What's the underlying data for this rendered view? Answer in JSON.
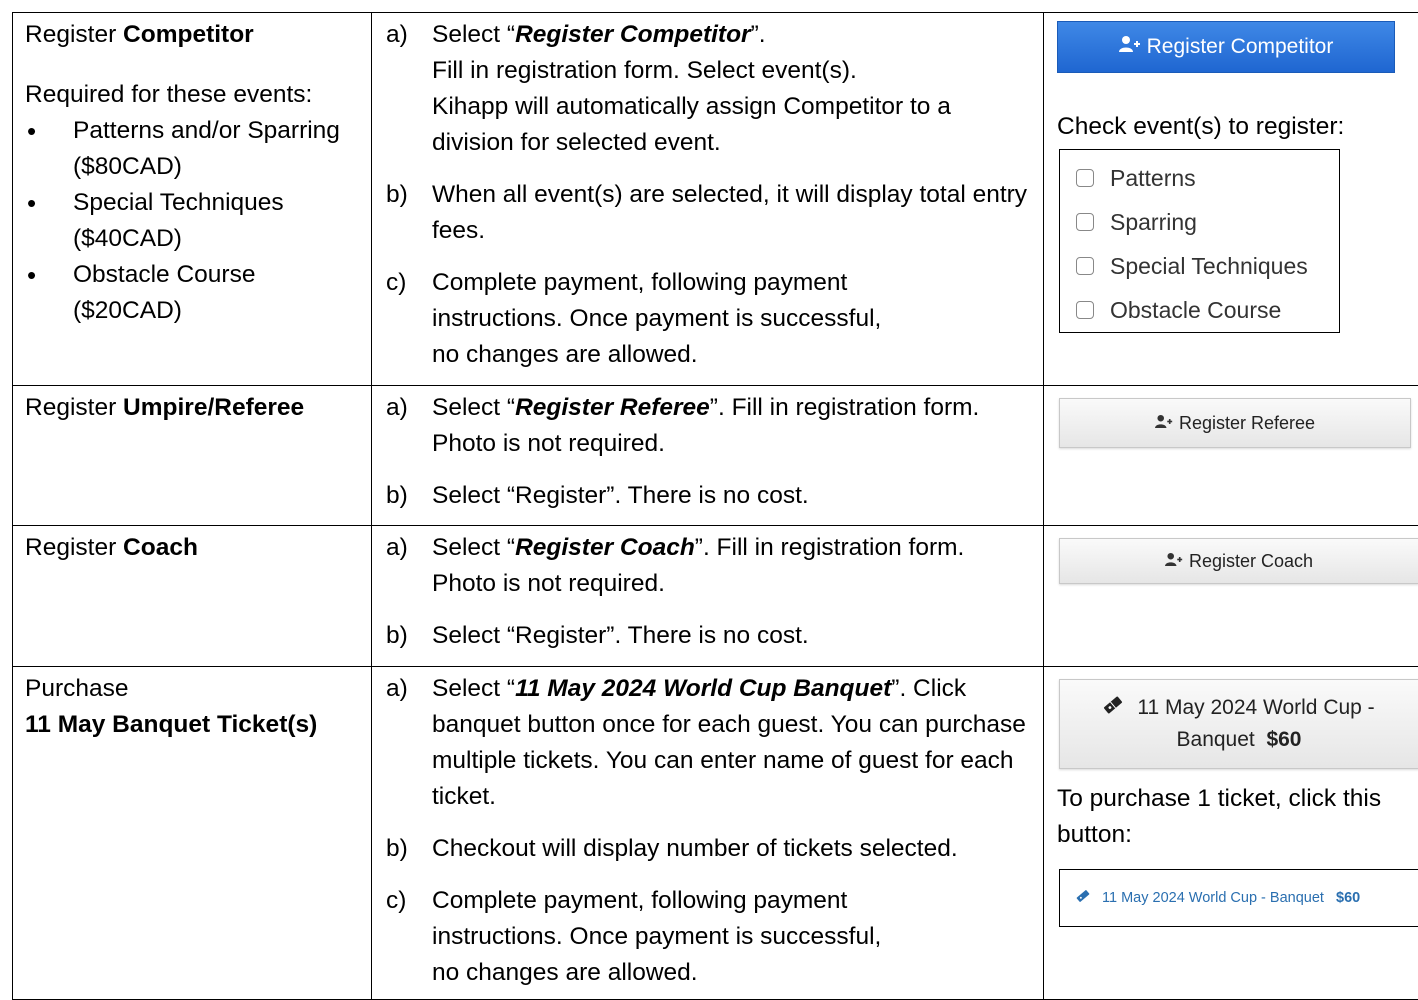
{
  "rows": {
    "competitor": {
      "title_prefix": "Register ",
      "title_bold": "Competitor",
      "required_text": "Required for these events:",
      "events": [
        "Patterns and/or Sparring ($80CAD)",
        "Special Techniques ($40CAD)",
        "Obstacle Course ($20CAD)"
      ],
      "steps": {
        "a": {
          "label": "a)",
          "pre": "Select “",
          "bi": "Register Competitor",
          "post": "”.",
          "line2": "Fill in registration form.  Select event(s).",
          "line3": "Kihapp will automatically assign Competitor to a division for selected event."
        },
        "b": {
          "label": "b)",
          "text": "When all event(s) are selected, it will display total entry fees."
        },
        "c": {
          "label": "c)",
          "line1": "Complete payment, following payment",
          "line2": "instructions.  Once payment is successful,",
          "line3": "no changes are allowed."
        }
      }
    },
    "referee": {
      "title_prefix": "Register ",
      "title_bold": "Umpire/Referee",
      "steps": {
        "a": {
          "label": "a)",
          "pre": "Select “",
          "bi": "Register Referee",
          "post": "”.  Fill in registration form.  Photo is not required."
        },
        "b": {
          "label": "b)",
          "text": "Select “Register”.  There is no cost."
        }
      }
    },
    "coach": {
      "title_prefix": "Register ",
      "title_bold": "Coach",
      "steps": {
        "a": {
          "label": "a)",
          "pre": "Select “",
          "bi": "Register Coach",
          "post": "”.  Fill in registration form.  Photo is not required."
        },
        "b": {
          "label": "b)",
          "text": "Select “Register”.  There is no cost."
        }
      }
    },
    "banquet": {
      "title_line1": "Purchase",
      "title_bold": "11 May Banquet Ticket(s)",
      "steps": {
        "a": {
          "label": "a)",
          "pre": "Select “",
          "bi": "11 May 2024 World Cup Banquet",
          "post": "”.  Click banquet button once for each guest.  You can purchase multiple tickets.  You can enter name of guest for each ticket."
        },
        "b": {
          "label": "b)",
          "text": "Checkout will display number of tickets selected."
        },
        "c": {
          "label": "c)",
          "line1": "Complete payment, following payment",
          "line2": "instructions.  Once payment is successful,",
          "line3": "no changes are allowed."
        }
      }
    }
  },
  "ui": {
    "register_competitor_button": "Register Competitor",
    "check_events_label": "Check event(s) to register:",
    "event_options": [
      "Patterns",
      "Sparring",
      "Special Techniques",
      "Obstacle Course"
    ],
    "register_referee_button": "Register Referee",
    "register_coach_button": "Register Coach",
    "banquet_button_line1": "11 May 2024 World Cup -",
    "banquet_button_line2": "Banquet",
    "banquet_button_price": "$60",
    "ticket_note": "To purchase 1 ticket, click this button:",
    "banquet_small_button": "11 May 2024 World Cup - Banquet",
    "banquet_small_price": "$60",
    "icons": {
      "user_add": "user-add-icon",
      "ticket": "ticket-icon"
    },
    "colors": {
      "primary_button": "#1f66d1",
      "link_blue": "#2a6fb0"
    }
  }
}
